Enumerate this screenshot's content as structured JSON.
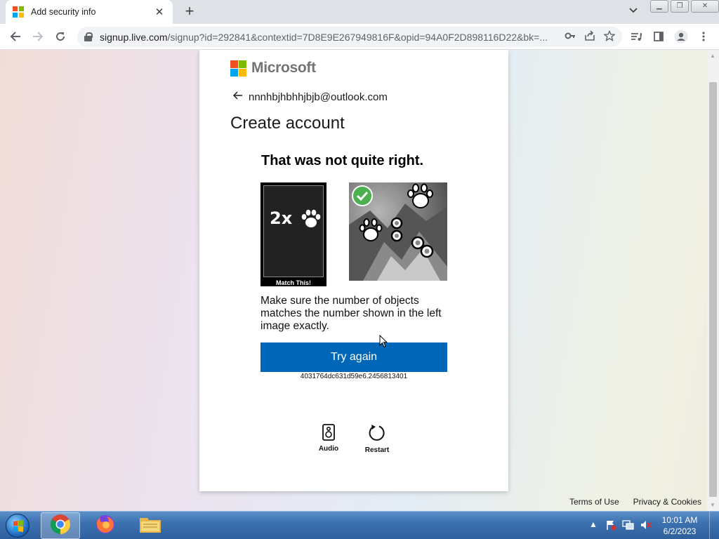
{
  "browser": {
    "tab": {
      "title": "Add security info"
    },
    "url": {
      "host": "signup.live.com",
      "rest": "/signup?id=292841&contextid=7D8E9E267949816F&opid=94A0F2D898116D22&bk=..."
    }
  },
  "colors": {
    "ms_red": "#f25022",
    "ms_green": "#7fba00",
    "ms_blue": "#00a4ef",
    "ms_yellow": "#ffb900",
    "primary_button": "#0067b8",
    "check_green": "#4caf50"
  },
  "page": {
    "brand": "Microsoft",
    "email": "nnnhbjhbhhjbjb@outlook.com",
    "title": "Create account",
    "captcha": {
      "heading": "That was not quite right.",
      "target_text": "2x",
      "target_icon": "paw-icon",
      "match_caption": "Match This!",
      "instruction": "Make sure the number of objects matches the number shown in the left image exactly.",
      "try_again_label": "Try again",
      "session_id": "4031764dc631d59e6.2456813401",
      "audio_label": "Audio",
      "restart_label": "Restart"
    },
    "footer": {
      "terms": "Terms of Use",
      "privacy": "Privacy & Cookies"
    }
  },
  "taskbar": {
    "apps": [
      "chrome-icon",
      "firefox-icon",
      "explorer-icon"
    ],
    "clock": {
      "time": "10:01 AM",
      "date": "6/2/2023"
    }
  }
}
